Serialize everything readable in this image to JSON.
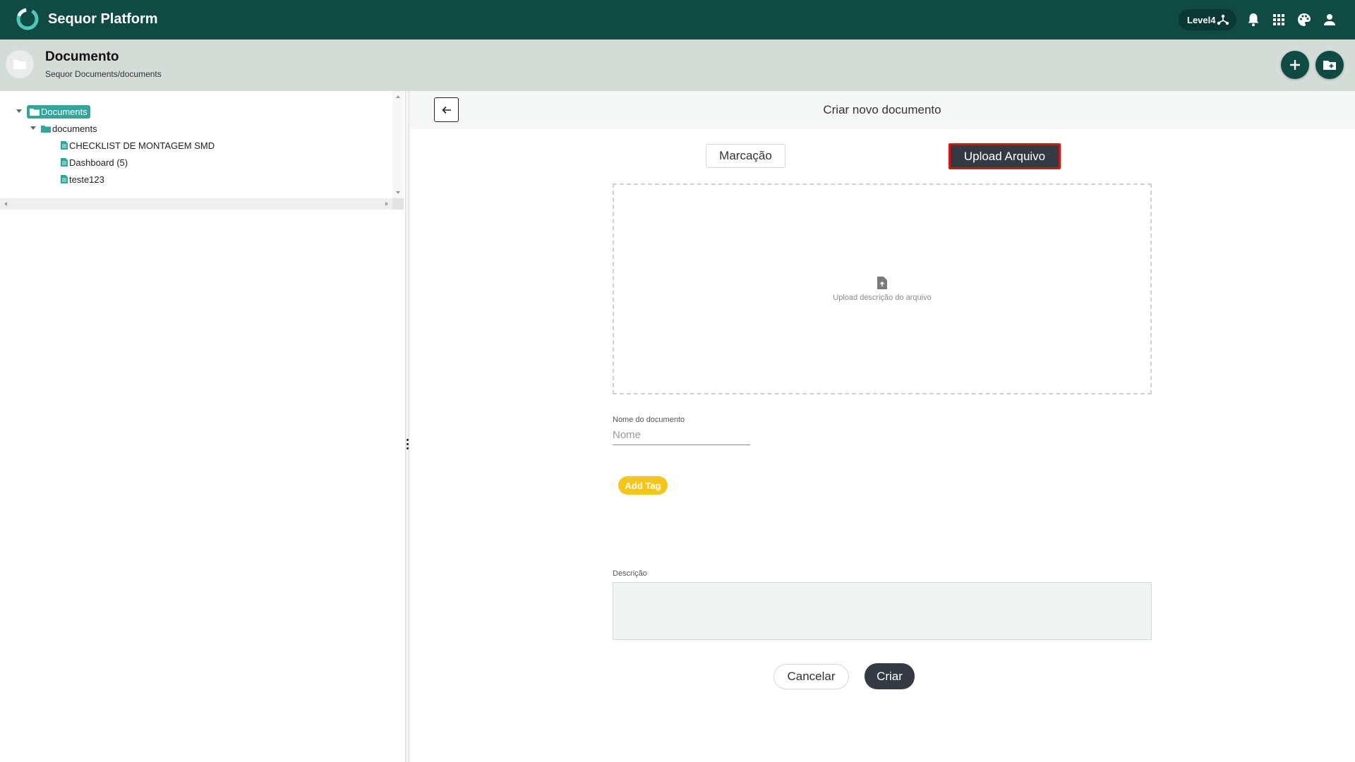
{
  "app": {
    "title": "Sequor Platform",
    "level_label": "Level4"
  },
  "topbar_icons": [
    "network-icon",
    "bell-icon",
    "apps-grid-icon",
    "palette-icon",
    "user-icon"
  ],
  "header": {
    "title": "Documento",
    "breadcrumb": "Sequor Documents/documents"
  },
  "tree": {
    "root": "Documents",
    "folder": "documents",
    "files": [
      "CHECKLIST DE MONTAGEM SMD",
      "Dashboard (5)",
      "teste123"
    ]
  },
  "form": {
    "title": "Criar novo documento",
    "tab_markup": "Marcação",
    "tab_upload": "Upload Arquivo",
    "dropzone_text": "Upload descrição do arquivo",
    "name_label": "Nome do documento",
    "name_placeholder": "Nome",
    "add_tag": "Add Tag",
    "description_label": "Descrição",
    "cancel": "Cancelar",
    "create": "Criar"
  },
  "colors": {
    "brand_dark": "#0f4a43",
    "header_band": "#d4dcd8",
    "tree_accent": "#2fa79a",
    "dark_button": "#343a44",
    "tag_yellow": "#f5c518",
    "highlight_red": "#e01010"
  }
}
